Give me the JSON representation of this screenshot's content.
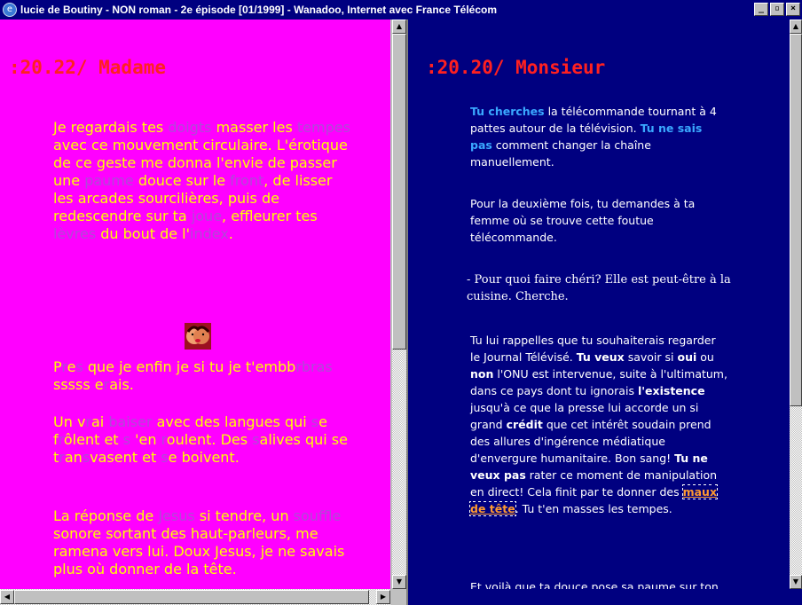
{
  "window": {
    "title": "lucie de Boutiny - NON roman - 2e épisode [01/1999] - Wanadoo, Internet avec France Télécom",
    "buttons": {
      "minimize": "_",
      "maximize": "▫",
      "close": "×"
    }
  },
  "left": {
    "heading": ":20.22/ Madame",
    "p1": [
      {
        "t": "Je regardais tes ",
        "dim": false
      },
      {
        "t": "doigts",
        "dim": true
      },
      {
        "t": " masser les ",
        "dim": false
      },
      {
        "t": "tempes",
        "dim": true
      },
      {
        "t": " avec ce mouvement circulaire. L'érotique de ce geste me donna l'envie de passer une ",
        "dim": false
      },
      {
        "t": "paume",
        "dim": true
      },
      {
        "t": " douce sur le ",
        "dim": false
      },
      {
        "t": "front",
        "dim": true
      },
      {
        "t": ", de lisser les arcades sourcilières, puis de redescendre sur ta ",
        "dim": false
      },
      {
        "t": "joue",
        "dim": true
      },
      {
        "t": ", effleurer tes ",
        "dim": false
      },
      {
        "t": "lèvres",
        "dim": true
      },
      {
        "t": " du bout de l'",
        "dim": false
      },
      {
        "t": "index",
        "dim": true
      },
      {
        "t": ".",
        "dim": false
      }
    ],
    "p2": [
      {
        "t": "P",
        "dim": false
      },
      {
        "t": "r",
        "dim": true
      },
      {
        "t": "e",
        "dim": false
      },
      {
        "t": "s",
        "dim": true
      },
      {
        "t": " que je enfin je si tu je t'embb",
        "dim": false
      },
      {
        "t": "rbras",
        "dim": true
      },
      {
        "t": " sssss e",
        "dim": false
      },
      {
        "t": "r",
        "dim": true
      },
      {
        "t": "ais.",
        "dim": false
      }
    ],
    "p3": [
      {
        "t": "Un v",
        "dim": false
      },
      {
        "t": "r",
        "dim": true
      },
      {
        "t": "ai ",
        "dim": false
      },
      {
        "t": "baiser",
        "dim": true
      },
      {
        "t": " avec des langues qui ",
        "dim": false
      },
      {
        "t": "s",
        "dim": true
      },
      {
        "t": "e f",
        "dim": false
      },
      {
        "t": "r",
        "dim": true
      },
      {
        "t": "ôlent et ",
        "dim": false
      },
      {
        "t": "s",
        "dim": true
      },
      {
        "t": " 'en ",
        "dim": false
      },
      {
        "t": "r",
        "dim": true
      },
      {
        "t": "oulent. Des ",
        "dim": false
      },
      {
        "t": "s",
        "dim": true
      },
      {
        "t": "alives qui se t",
        "dim": false
      },
      {
        "t": "r",
        "dim": true
      },
      {
        "t": "an",
        "dim": false
      },
      {
        "t": "s",
        "dim": true
      },
      {
        "t": "vasent et ",
        "dim": false
      },
      {
        "t": "s",
        "dim": true
      },
      {
        "t": "e boivent.",
        "dim": false
      }
    ],
    "p4": [
      {
        "t": "La réponse de ",
        "dim": false
      },
      {
        "t": "Jesus",
        "dim": true
      },
      {
        "t": " si tendre, un ",
        "dim": false
      },
      {
        "t": "souffle",
        "dim": true
      },
      {
        "t": " sonore sortant des haut-parleurs, me ramena vers lui. Doux Jesus, je ne savais plus où donner de la tête.",
        "dim": false
      }
    ]
  },
  "right": {
    "heading": ":20.20/ Monsieur",
    "p1": [
      {
        "t": "Tu cherches",
        "s": "blue"
      },
      {
        "t": " la télécommande tournant à 4 pattes autour de la télévision. ",
        "s": ""
      },
      {
        "t": "Tu ne sais pas",
        "s": "blue"
      },
      {
        "t": " comment changer la chaîne manuellement.",
        "s": ""
      }
    ],
    "p2": "Pour la deuxième fois, tu demandes à ta femme où se trouve cette foutue télécommande.",
    "p3": "- Pour quoi faire chéri? Elle est peut-être à la cuisine. Cherche.",
    "p4": [
      {
        "t": "Tu lui rappelles que tu souhaiterais regarder le Journal Télévisé. ",
        "s": ""
      },
      {
        "t": "Tu veux",
        "s": "b"
      },
      {
        "t": " savoir si ",
        "s": ""
      },
      {
        "t": "oui",
        "s": "b"
      },
      {
        "t": " ou ",
        "s": ""
      },
      {
        "t": "non",
        "s": "b"
      },
      {
        "t": " l'ONU est intervenue, suite à l'ultimatum, dans ce pays dont tu ignorais ",
        "s": ""
      },
      {
        "t": "l'existence",
        "s": "b"
      },
      {
        "t": " jusqu'à ce que la presse lui accorde un si grand ",
        "s": ""
      },
      {
        "t": "crédit",
        "s": "b"
      },
      {
        "t": " que cet intérêt soudain prend des allures d'ingérence médiatique d'envergure humanitaire. Bon sang! ",
        "s": ""
      },
      {
        "t": "Tu ne veux pas",
        "s": "b"
      },
      {
        "t": " rater ce moment de manipulation en direct! Cela finit par te donner des ",
        "s": ""
      },
      {
        "t": "maux de tête",
        "s": "link"
      },
      {
        "t": ". Tu t'en masses les tempes.",
        "s": ""
      }
    ],
    "p5": "Et voilà que ta douce pose sa paume sur ton front et te console d'un ton"
  },
  "icons": {
    "app": "ie-icon",
    "face": "kissing-faces-icon"
  },
  "colors": {
    "left_bg": "#ff00ff",
    "left_text": "#ffff00",
    "left_dim": "#b048d8",
    "heading": "#ff2020",
    "right_bg": "#000080",
    "right_highlight": "#3aa8ff",
    "link": "#ff9a30"
  }
}
